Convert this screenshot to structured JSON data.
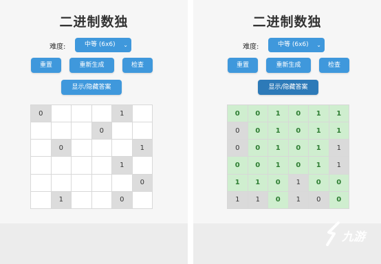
{
  "left": {
    "title": "二进制数独",
    "difficulty_label": "难度:",
    "difficulty_value": "中等 (6x6)",
    "buttons": {
      "reset": "重置",
      "regenerate": "重新生成",
      "check": "检查",
      "toggle_answer": "显示/隐藏答案"
    },
    "grid": [
      [
        "0",
        "",
        "",
        "",
        "1",
        ""
      ],
      [
        "",
        "",
        "",
        "0",
        "",
        ""
      ],
      [
        "",
        "0",
        "",
        "",
        "",
        "1"
      ],
      [
        "",
        "",
        "",
        "",
        "1",
        ""
      ],
      [
        "",
        "",
        "",
        "",
        "",
        "0"
      ],
      [
        "",
        "1",
        "",
        "",
        "0",
        ""
      ]
    ]
  },
  "right": {
    "title": "二进制数独",
    "difficulty_label": "难度:",
    "difficulty_value": "中等 (6x6)",
    "buttons": {
      "reset": "重置",
      "regenerate": "重新生成",
      "check": "检查",
      "toggle_answer": "显示/隐藏答案"
    },
    "grid": [
      [
        "0",
        "0",
        "1",
        "0",
        "1",
        "1"
      ],
      [
        "0",
        "0",
        "1",
        "0",
        "1",
        "1"
      ],
      [
        "0",
        "0",
        "1",
        "0",
        "1",
        "1"
      ],
      [
        "0",
        "0",
        "1",
        "0",
        "1",
        "1"
      ],
      [
        "1",
        "1",
        "0",
        "1",
        "0",
        "0"
      ],
      [
        "1",
        "1",
        "0",
        "1",
        "0",
        "0"
      ]
    ]
  },
  "watermark": {
    "text": "九游",
    "icon": "swoosh-logo-icon"
  },
  "colors": {
    "button": "#3f98dc",
    "button_active": "#2d7ab8",
    "correct_cell": "#cfeecf",
    "fixed_cell": "#dcdcdc"
  }
}
